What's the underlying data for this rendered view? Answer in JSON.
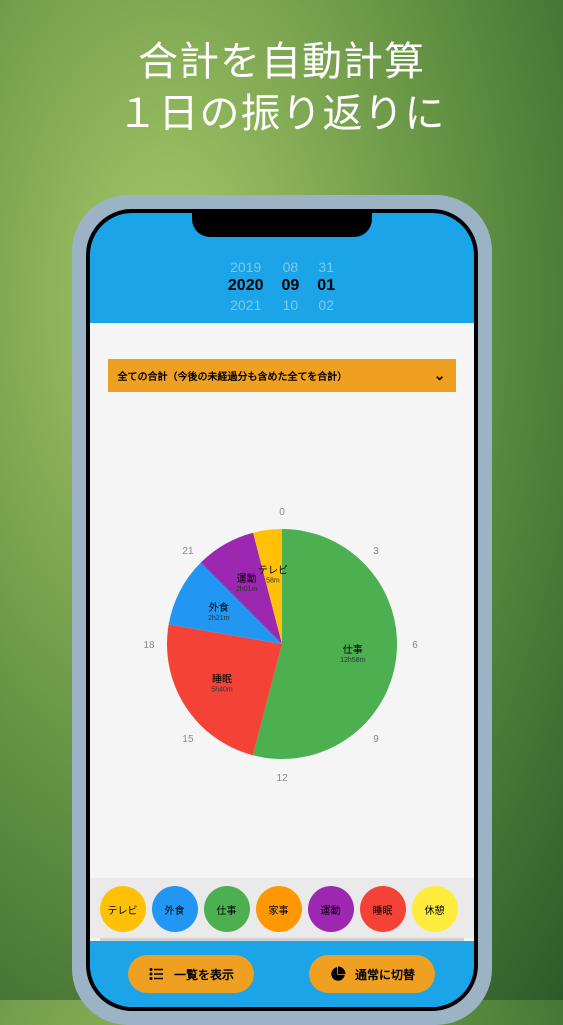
{
  "promo": {
    "line1": "合計を自動計算",
    "line2": "１日の振り返りに"
  },
  "date_picker": {
    "year": {
      "prev": "2019",
      "current": "2020",
      "next": "2021"
    },
    "month": {
      "prev": "08",
      "current": "09",
      "next": "10"
    },
    "day": {
      "prev": "31",
      "current": "01",
      "next": "02"
    }
  },
  "dropdown": {
    "label": "全ての合計（今後の未経過分も含めた全てを合計）"
  },
  "clock_labels": [
    "0",
    "3",
    "6",
    "9",
    "12",
    "15",
    "18",
    "21"
  ],
  "chart_data": {
    "type": "pie",
    "title": "",
    "series": [
      {
        "name": "仕事",
        "label": "仕事",
        "sublabel": "12h58m",
        "value": 12.97,
        "color": "#4caf50"
      },
      {
        "name": "睡眠",
        "label": "睡眠",
        "sublabel": "5h40m",
        "value": 5.67,
        "color": "#f44336"
      },
      {
        "name": "外食",
        "label": "外食",
        "sublabel": "2h21m",
        "value": 2.35,
        "color": "#2196f3"
      },
      {
        "name": "運動",
        "label": "運動",
        "sublabel": "2h01m",
        "value": 2.02,
        "color": "#9c27b0"
      },
      {
        "name": "テレビ",
        "label": "テレビ",
        "sublabel": "58m",
        "value": 0.97,
        "color": "#ffc107"
      }
    ]
  },
  "categories": [
    {
      "label": "テレビ",
      "color": "#ffc107"
    },
    {
      "label": "外食",
      "color": "#2196f3"
    },
    {
      "label": "仕事",
      "color": "#4caf50"
    },
    {
      "label": "家事",
      "color": "#ff9800"
    },
    {
      "label": "運動",
      "color": "#9c27b0"
    },
    {
      "label": "睡眠",
      "color": "#f44336"
    },
    {
      "label": "休憩",
      "color": "#ffeb3b"
    }
  ],
  "buttons": {
    "list": "一覧を表示",
    "toggle": "通常に切替"
  }
}
